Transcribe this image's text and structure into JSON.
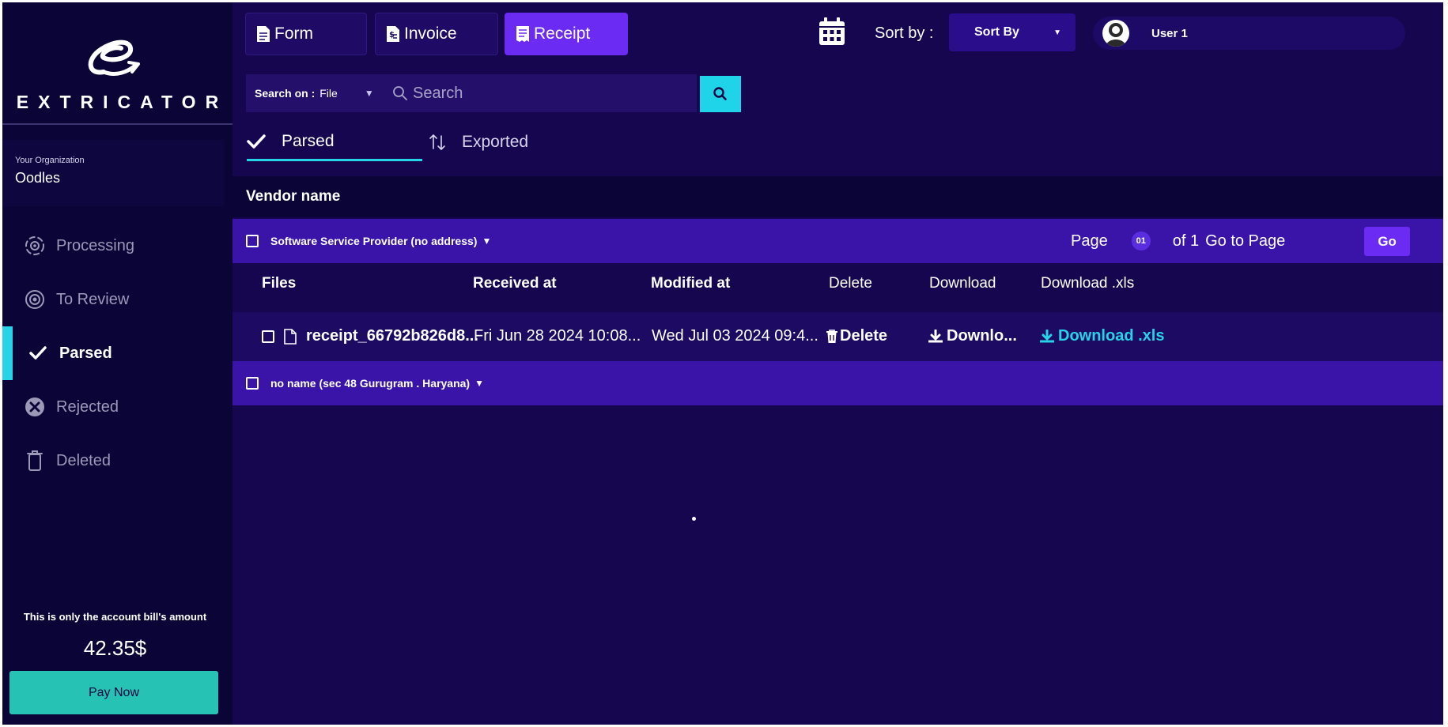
{
  "brand": {
    "name": "EXTRICATOR"
  },
  "sidebar": {
    "org_label": "Your Organization",
    "org_name": "Oodles",
    "items": [
      {
        "label": "Processing",
        "icon": "processing-gear-icon",
        "active": false
      },
      {
        "label": "To Review",
        "icon": "eye-icon",
        "active": false
      },
      {
        "label": "Parsed",
        "icon": "check-icon",
        "active": true
      },
      {
        "label": "Rejected",
        "icon": "x-circle-icon",
        "active": false
      },
      {
        "label": "Deleted",
        "icon": "trash-icon",
        "active": false
      }
    ],
    "bill_text": "This is only the account bill's amount",
    "bill_amount": "42.35$",
    "pay_label": "Pay Now"
  },
  "doc_tabs": [
    {
      "label": "Form",
      "active": false
    },
    {
      "label": "Invoice",
      "active": false
    },
    {
      "label": "Receipt",
      "active": true
    }
  ],
  "toolbar": {
    "sort_label": "Sort by :",
    "sort_value": "Sort By",
    "user_name": "User 1"
  },
  "search": {
    "on_label": "Search on :",
    "on_value": "File",
    "placeholder": "Search"
  },
  "sub_tabs": [
    {
      "label": "Parsed",
      "active": true
    },
    {
      "label": "Exported",
      "active": false
    }
  ],
  "table": {
    "vendor_header": "Vendor name",
    "groups": [
      {
        "name": "Software Service Provider (no address)"
      },
      {
        "name": "no name (sec 48 Gurugram . Haryana)"
      }
    ],
    "pager": {
      "page_label": "Page",
      "page_num": "01",
      "of_label": "of 1",
      "goto_label": "Go to Page",
      "go_label": "Go"
    },
    "columns": [
      "Files",
      "Received at",
      "Modified at",
      "Delete",
      "Download",
      "Download .xls"
    ],
    "rows": [
      {
        "file": "receipt_66792b826d8...",
        "received": "Fri Jun 28 2024 10:08...",
        "modified": "Wed Jul 03 2024 09:4...",
        "delete": "Delete",
        "download": "Downlo...",
        "download_xls": "Download .xls"
      }
    ]
  },
  "colors": {
    "accent_cyan": "#27d3e6",
    "accent_purple": "#6b2bf2",
    "pay_teal": "#26c3b4",
    "background": "#15064f"
  }
}
